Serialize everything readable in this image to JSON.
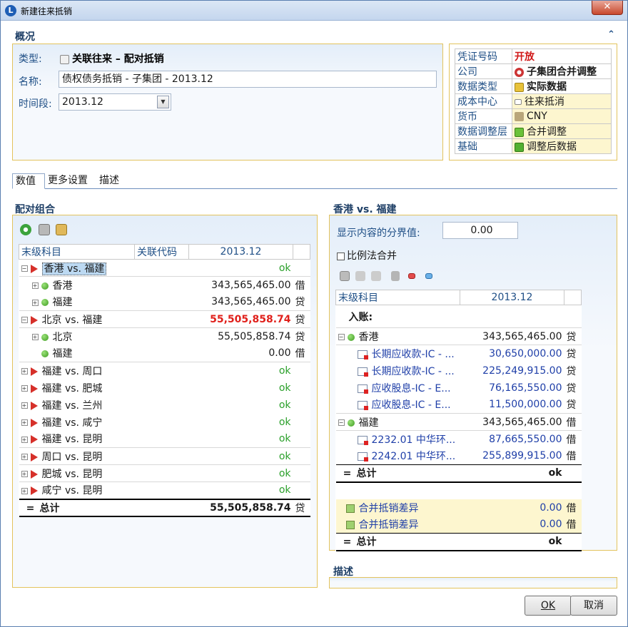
{
  "window": {
    "title": "新建往来抵销",
    "close": "✕"
  },
  "overview": {
    "title": "概况",
    "collapse": "⌃",
    "type_label": "类型:",
    "type_value": "关联往来 – 配对抵销",
    "name_label": "名称:",
    "name_value": "债权债务抵销 - 子集团 - 2013.12",
    "period_label": "时间段:",
    "period_value": "2013.12"
  },
  "props": [
    {
      "k": "凭证号码",
      "v": "开放"
    },
    {
      "k": "公司",
      "v": "子集团合并调整"
    },
    {
      "k": "数据类型",
      "v": "实际数据"
    },
    {
      "k": "成本中心",
      "v": "往来抵消"
    },
    {
      "k": "货币",
      "v": "CNY"
    },
    {
      "k": "数据调整层",
      "v": "合并调整"
    },
    {
      "k": "基础",
      "v": "调整后数据"
    }
  ],
  "tabs": [
    "数值",
    "更多设置",
    "描述"
  ],
  "pair": {
    "title": "配对组合",
    "headers": [
      "末级科目",
      "关联代码",
      "2013.12"
    ],
    "rows": [
      {
        "label": "香港 vs. 福建",
        "value": "ok",
        "dc": ""
      },
      {
        "label": "香港",
        "value": "343,565,465.00",
        "dc": "借"
      },
      {
        "label": "福建",
        "value": "343,565,465.00",
        "dc": "贷"
      },
      {
        "label": "北京 vs. 福建",
        "value": "55,505,858.74",
        "dc": "贷"
      },
      {
        "label": "北京",
        "value": "55,505,858.74",
        "dc": "贷"
      },
      {
        "label": "福建",
        "value": "0.00",
        "dc": "借"
      },
      {
        "label": "福建 vs. 周口",
        "value": "ok",
        "dc": ""
      },
      {
        "label": "福建 vs. 肥城",
        "value": "ok",
        "dc": ""
      },
      {
        "label": "福建 vs. 兰州",
        "value": "ok",
        "dc": ""
      },
      {
        "label": "福建 vs. 咸宁",
        "value": "ok",
        "dc": ""
      },
      {
        "label": "福建 vs. 昆明",
        "value": "ok",
        "dc": ""
      },
      {
        "label": "周口 vs. 昆明",
        "value": "ok",
        "dc": ""
      },
      {
        "label": "肥城 vs. 昆明",
        "value": "ok",
        "dc": ""
      },
      {
        "label": "咸宁 vs. 昆明",
        "value": "ok",
        "dc": ""
      }
    ],
    "total": {
      "eq": "=",
      "label": "总计",
      "value": "55,505,858.74",
      "dc": "贷"
    }
  },
  "detail": {
    "title": "香港 vs. 福建",
    "threshold_label": "显示内容的分界值:",
    "threshold_value": "0.00",
    "proportional": "比例法合并",
    "headers": [
      "末级科目",
      "2013.12"
    ],
    "entry": "入账:",
    "rows": [
      {
        "label": "香港",
        "value": "343,565,465.00",
        "dc": "贷"
      },
      {
        "label": "长期应收款-IC - ...",
        "value": "30,650,000.00",
        "dc": "贷"
      },
      {
        "label": "长期应收款-IC - ...",
        "value": "225,249,915.00",
        "dc": "贷"
      },
      {
        "label": "应收股息-IC - E...",
        "value": "76,165,550.00",
        "dc": "贷"
      },
      {
        "label": "应收股息-IC - E...",
        "value": "11,500,000.00",
        "dc": "贷"
      },
      {
        "label": "福建",
        "value": "343,565,465.00",
        "dc": "借"
      },
      {
        "label": "2232.01 中华环...",
        "value": "87,665,550.00",
        "dc": "借"
      },
      {
        "label": "2242.01 中华环...",
        "value": "255,899,915.00",
        "dc": "借"
      }
    ],
    "sum1": {
      "eq": "=",
      "label": "总计",
      "value": "ok"
    },
    "diff": [
      {
        "label": "合并抵销差异",
        "value": "0.00",
        "dc": "借"
      },
      {
        "label": "合并抵销差异",
        "value": "0.00",
        "dc": "借"
      }
    ],
    "sum2": {
      "eq": "=",
      "label": "总计",
      "value": "ok"
    }
  },
  "description": {
    "title": "描述"
  },
  "buttons": {
    "ok": "OK",
    "cancel": "取消"
  }
}
